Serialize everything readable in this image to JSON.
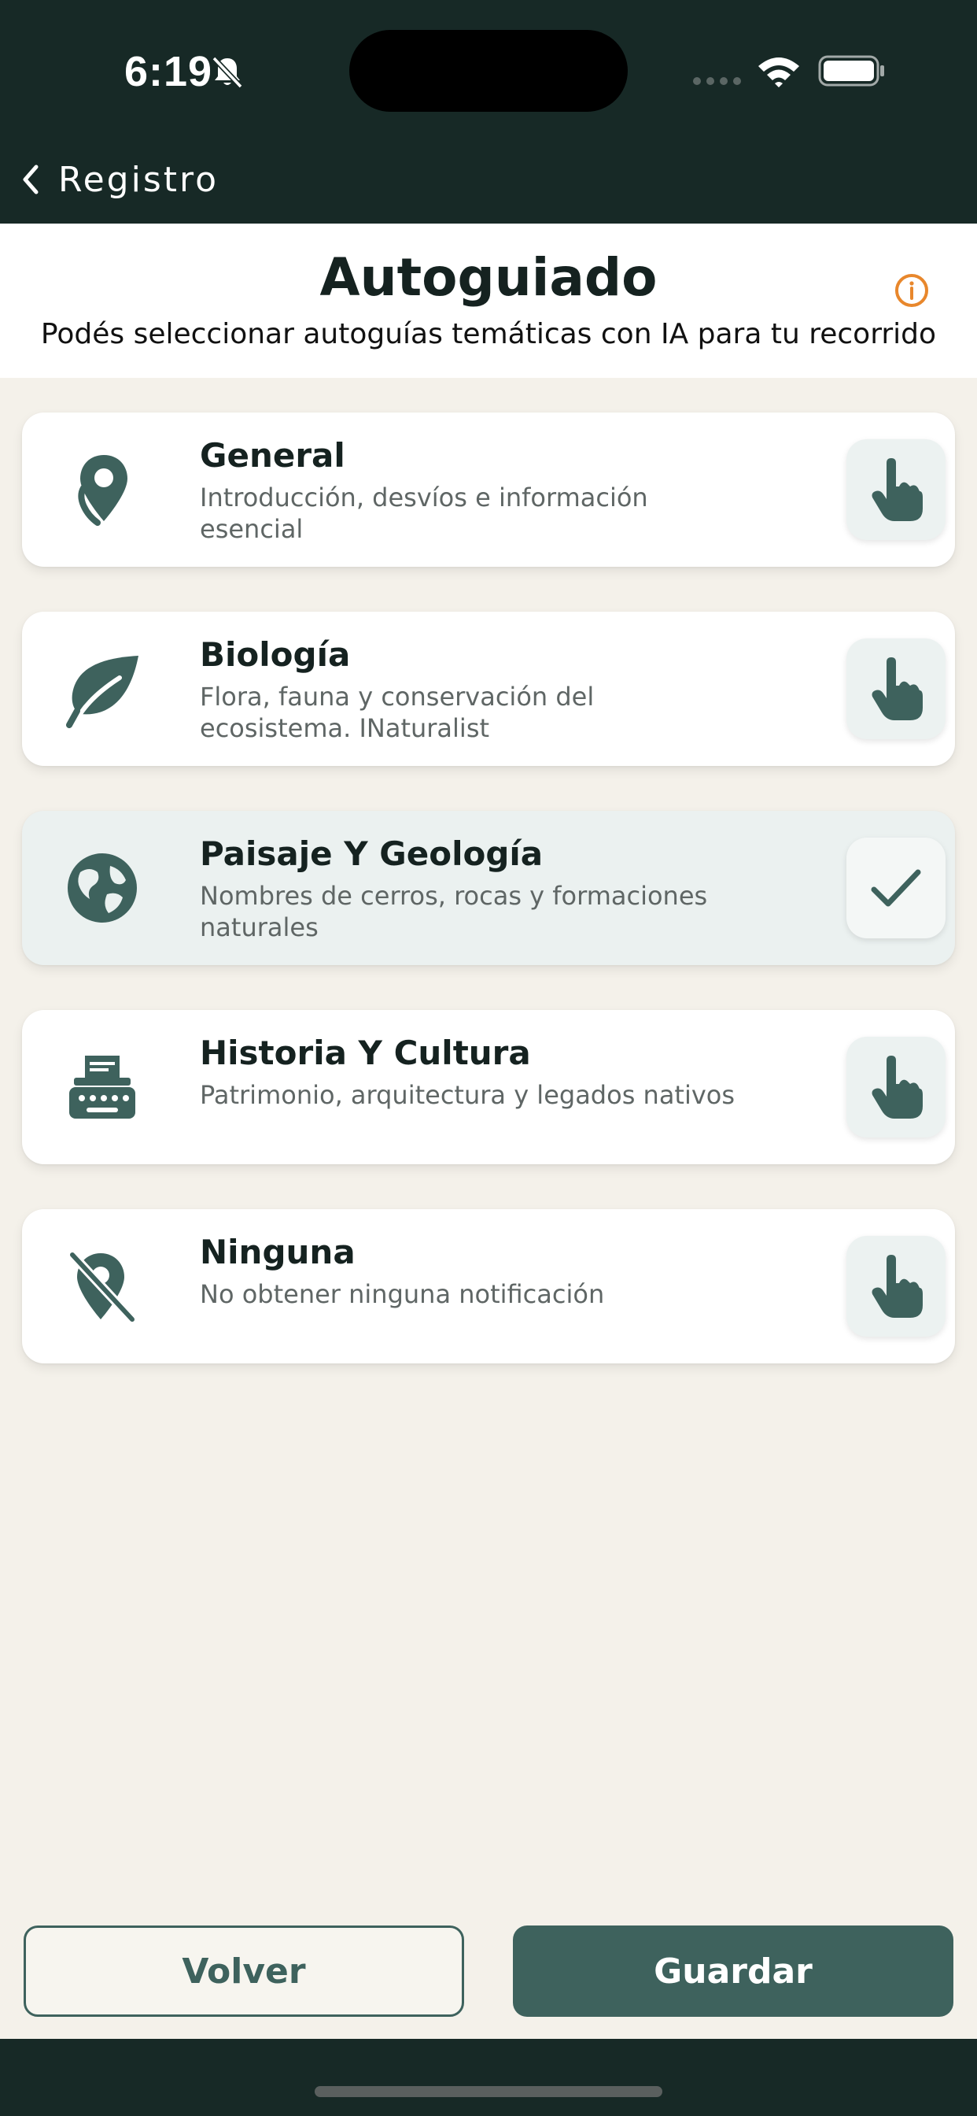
{
  "status_bar": {
    "time": "6:19"
  },
  "nav": {
    "back_label": "Registro"
  },
  "header": {
    "title": "Autoguiado",
    "subtitle": "Podés seleccionar autoguías temáticas con IA para tu recorrido"
  },
  "options": [
    {
      "title": "General",
      "description": "Introducción, desvíos e información esencial",
      "icon": "map-pin-icon",
      "selected": false
    },
    {
      "title": "Biología",
      "description": "Flora, fauna y conservación del ecosistema. INaturalist",
      "icon": "leaf-icon",
      "selected": false
    },
    {
      "title": "Paisaje Y Geología",
      "description": "Nombres de cerros, rocas y formaciones naturales",
      "icon": "globe-icon",
      "selected": true
    },
    {
      "title": "Historia Y Cultura",
      "description": "Patrimonio, arquitectura y legados nativos",
      "icon": "typewriter-icon",
      "selected": false
    },
    {
      "title": "Ninguna",
      "description": "No obtener ninguna notificación",
      "icon": "map-pin-off-icon",
      "selected": false
    }
  ],
  "buttons": {
    "back": "Volver",
    "save": "Guardar"
  },
  "colors": {
    "header_bg": "#172926",
    "primary": "#3e625d",
    "background": "#f4f1ea",
    "info_accent": "#e8872c"
  }
}
